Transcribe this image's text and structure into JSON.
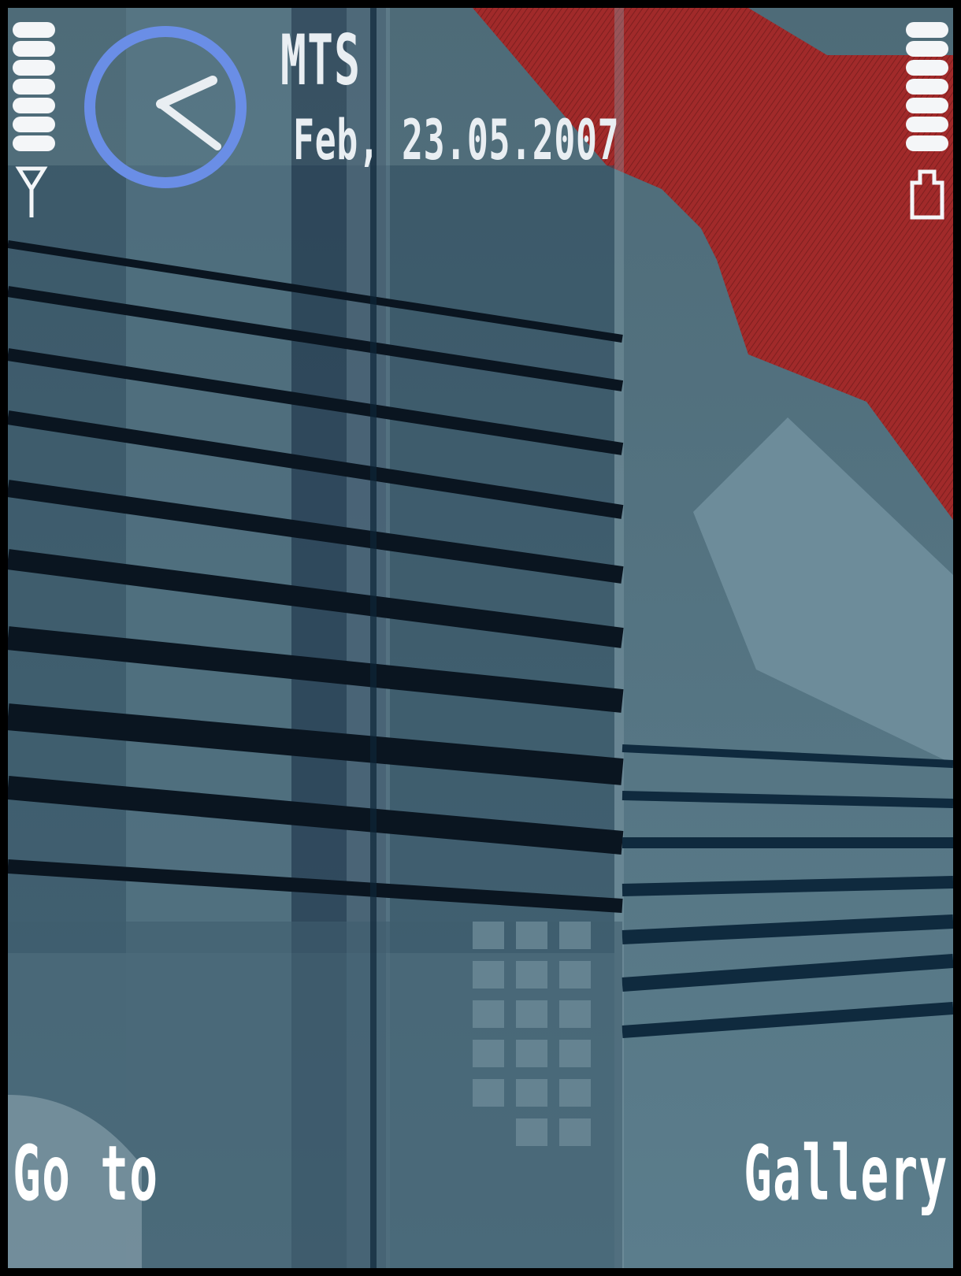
{
  "status": {
    "operator": "MTS",
    "date": "Feb, 23.05.2007",
    "signal_bars": 7,
    "battery_bars": 7
  },
  "icons": {
    "signal": "antenna-icon",
    "battery": "battery-icon",
    "clock": "analog-clock-icon"
  },
  "softkeys": {
    "left": "Go to",
    "right": "Gallery"
  },
  "theme_colors": {
    "accent_red": "#a12a2a",
    "clock_ring": "#6a8ee6",
    "text": "#e9eef2"
  }
}
